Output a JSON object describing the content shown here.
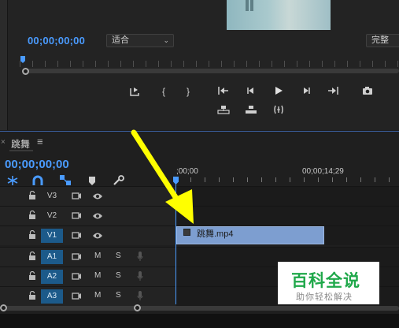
{
  "monitor": {
    "timecode": "00;00;00;00",
    "fit_value": "适合",
    "quality_value": "完整"
  },
  "timeline": {
    "tab_label": "跳舞",
    "timecode": "00;00;00;00",
    "ruler_start": ";00;00",
    "ruler_mark": "00;00;14;29",
    "video_tracks": [
      {
        "id": "V3",
        "target": false
      },
      {
        "id": "V2",
        "target": false
      },
      {
        "id": "V1",
        "target": true
      }
    ],
    "audio_tracks": [
      {
        "id": "A1",
        "target": true,
        "mute": "M",
        "solo": "S"
      },
      {
        "id": "A2",
        "target": true,
        "mute": "M",
        "solo": "S"
      },
      {
        "id": "A3",
        "target": true,
        "mute": "M",
        "solo": "S"
      }
    ],
    "clip": {
      "name": "跳舞.mp4",
      "color": "#7d9ed0"
    }
  },
  "colors": {
    "accent": "#4a9bff",
    "work_area": "#e2e233",
    "arrow": "#ffff00",
    "track_target": "#1c5a8a"
  },
  "watermark": {
    "title": "百科全说",
    "subtitle": "助你轻松解决"
  }
}
